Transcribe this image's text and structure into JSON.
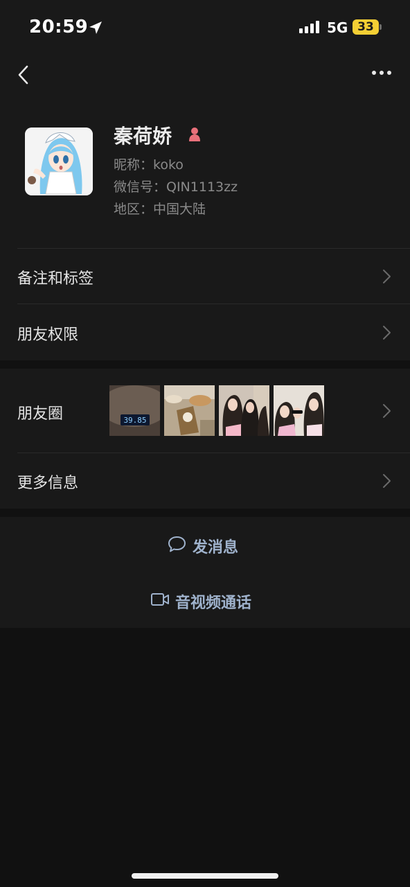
{
  "status_bar": {
    "time": "20:59",
    "network": "5G",
    "battery": "33",
    "icons": [
      "location-arrow-icon",
      "signal-bars-icon",
      "battery-icon"
    ]
  },
  "nav": {
    "back_icon": "chevron-left-icon",
    "more_icon": "ellipsis-icon"
  },
  "profile": {
    "name": "秦荷娇",
    "gender_icon": "female-icon",
    "nickname": "昵称：koko",
    "wechat_id": "微信号：QIN1113zz",
    "region": "地区：中国大陆"
  },
  "rows": {
    "notes_tags": "备注和标签",
    "friend_permissions": "朋友权限",
    "moments": "朋友圈",
    "more_info": "更多信息"
  },
  "moments_thumbs": {
    "scale_reading": "39.85"
  },
  "actions": {
    "send_message": "发消息",
    "video_call": "音视频通话"
  },
  "colors": {
    "background": "#111111",
    "panel": "#191919",
    "action_text": "#9fb2cc",
    "battery": "#f4cf34",
    "gender_icon": "#e8707a"
  }
}
